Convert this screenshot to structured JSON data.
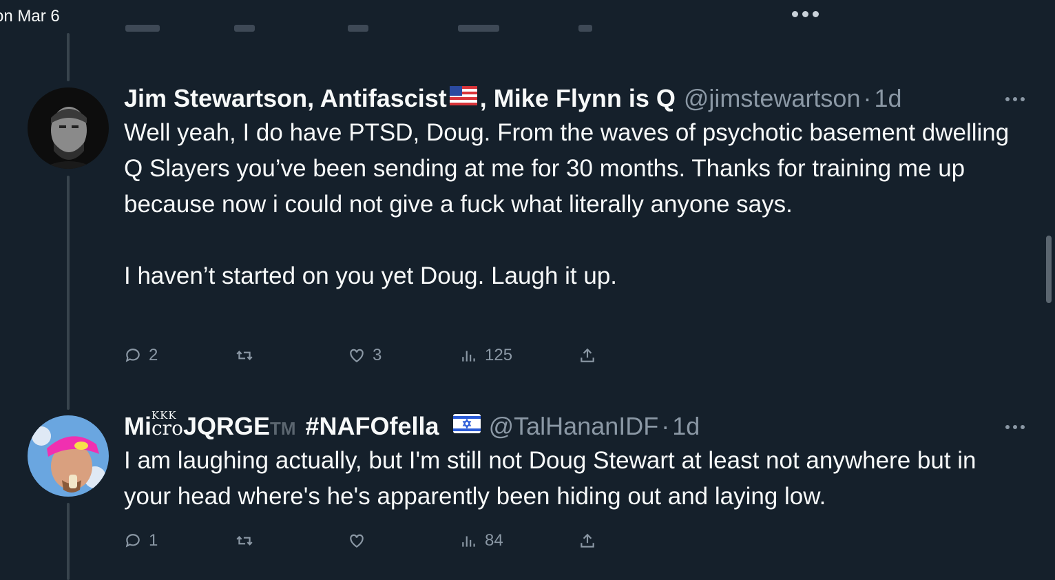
{
  "top": {
    "date_label": "on Mar 6"
  },
  "tweets": [
    {
      "display_name_prefix": "Jim Stewartson, Antifascist",
      "display_name_suffix": ", Mike Flynn is Q",
      "handle": "@jimstewartson",
      "separator": "·",
      "time": "1d",
      "body_paragraphs": [
        "Well yeah, I do have PTSD, Doug. From the waves of psychotic basement dwelling Q Slayers you’ve been sending at me for 30 months. Thanks for training me up because now i could not give a fuck what literally anyone says.",
        "I haven’t started on you yet Doug. Laugh it up."
      ],
      "replies": "2",
      "retweets": "",
      "likes": "3",
      "views": "125"
    },
    {
      "display_name_prefix": "Mi",
      "display_name_kkk": "KKK",
      "display_name_cro": "cro",
      "display_name_main": "JQRGE",
      "display_name_tm": "TM",
      "display_name_tag": "#NAFOfella",
      "handle": "@TalHananIDF",
      "separator": "·",
      "time": "1d",
      "body_paragraphs": [
        "I am laughing actually, but I'm still not Doug Stewart at least not anywhere but in your head where's he's apparently been hiding out and laying low."
      ],
      "replies": "1",
      "retweets": "",
      "likes": "",
      "views": "84"
    }
  ],
  "colors": {
    "background": "#15202b",
    "text": "#f7f9f9",
    "secondary": "#8b98a5",
    "thread_line": "#38444d"
  },
  "icons": [
    "reply-icon",
    "retweet-icon",
    "like-icon",
    "views-icon",
    "share-icon",
    "more-icon",
    "us-flag-icon",
    "israel-flag-icon"
  ]
}
